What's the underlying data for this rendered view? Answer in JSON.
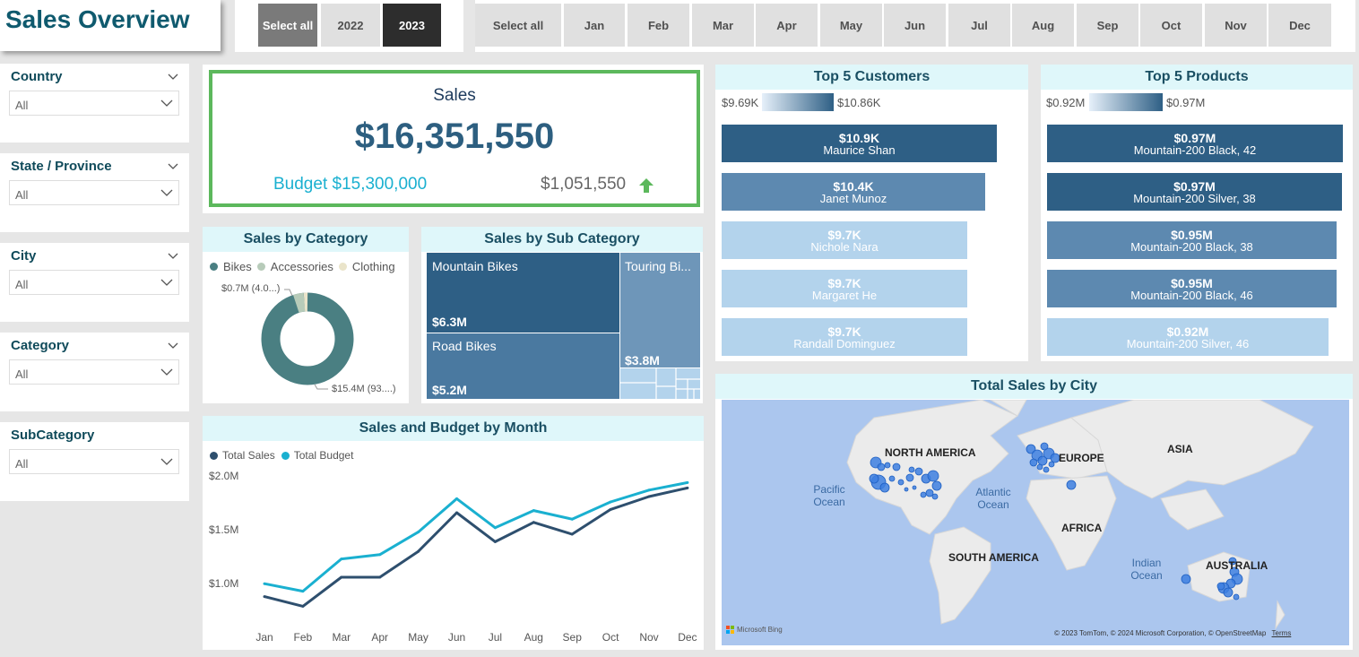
{
  "header": {
    "title": "Sales Overview"
  },
  "year_slicer": {
    "items": [
      "Select all",
      "2022",
      "2023"
    ],
    "selected": "2023"
  },
  "month_slicer": {
    "items": [
      "Select all",
      "Jan",
      "Feb",
      "Mar",
      "Apr",
      "May",
      "Jun",
      "Jul",
      "Aug",
      "Sep",
      "Oct",
      "Nov",
      "Dec"
    ]
  },
  "filters": [
    {
      "label": "Country",
      "value": "All"
    },
    {
      "label": "State / Province",
      "value": "All"
    },
    {
      "label": "City",
      "value": "All"
    },
    {
      "label": "Category",
      "value": "All"
    },
    {
      "label": "SubCategory",
      "value": "All"
    }
  ],
  "kpi": {
    "title": "Sales",
    "value": "$16,351,550",
    "budget": "Budget $15,300,000",
    "variance": "$1,051,550",
    "variance_direction": "up",
    "accent_color": "#5cb85c",
    "budget_color": "#1ab0d0",
    "value_color": "#2d5f80"
  },
  "category_chart": {
    "title": "Sales by Category",
    "legend": [
      "Bikes",
      "Accessories",
      "Clothing"
    ],
    "colors": [
      "#4a7f82",
      "#b7cbb9",
      "#eae4ca"
    ],
    "label_small": "$0.7M (4.0...)",
    "label_big": "$15.4M (93....)"
  },
  "subcategory_chart": {
    "title": "Sales by Sub Category",
    "tiles": [
      {
        "name": "Mountain Bikes",
        "value": "$6.3M"
      },
      {
        "name": "Road Bikes",
        "value": "$5.2M"
      },
      {
        "name": "Touring Bi...",
        "value": "$3.8M"
      }
    ]
  },
  "line_chart": {
    "title": "Sales and Budget by Month",
    "legend": [
      "Total Sales",
      "Total Budget"
    ],
    "y_ticks": [
      "$2.0M",
      "$1.5M",
      "$1.0M"
    ],
    "x_ticks": [
      "Jan",
      "Feb",
      "Mar",
      "Apr",
      "May",
      "Jun",
      "Jul",
      "Aug",
      "Sep",
      "Oct",
      "Nov",
      "Dec"
    ]
  },
  "chart_data": {
    "type": "line",
    "x": [
      "Jan",
      "Feb",
      "Mar",
      "Apr",
      "May",
      "Jun",
      "Jul",
      "Aug",
      "Sep",
      "Oct",
      "Nov",
      "Dec"
    ],
    "series": [
      {
        "name": "Total Sales",
        "color": "#2e4f6e",
        "values": [
          0.87,
          0.78,
          1.05,
          1.05,
          1.29,
          1.65,
          1.38,
          1.56,
          1.45,
          1.68,
          1.8,
          1.88
        ]
      },
      {
        "name": "Total Budget",
        "color": "#1ab0d0",
        "values": [
          0.99,
          0.92,
          1.22,
          1.26,
          1.47,
          1.78,
          1.51,
          1.67,
          1.59,
          1.75,
          1.86,
          1.93
        ]
      }
    ],
    "ylim": [
      0.7,
      2.1
    ],
    "y_unit": "$M",
    "grid": false,
    "legend_position": "top-left"
  },
  "top_customers": {
    "title": "Top 5 Customers",
    "range_min": "$9.69K",
    "range_max": "$10.86K",
    "items": [
      {
        "value": "$10.9K",
        "name": "Maurice Shan",
        "fraction": 1.0,
        "color": "#2e5f85"
      },
      {
        "value": "$10.4K",
        "name": "Janet Munoz",
        "fraction": 0.958,
        "color": "#5d89b0"
      },
      {
        "value": "$9.7K",
        "name": "Nichole Nara",
        "fraction": 0.893,
        "color": "#b3d3ec"
      },
      {
        "value": "$9.7K",
        "name": "Margaret He",
        "fraction": 0.893,
        "color": "#b3d3ec"
      },
      {
        "value": "$9.7K",
        "name": "Randall Dominguez",
        "fraction": 0.893,
        "color": "#b3d3ec"
      }
    ]
  },
  "top_products": {
    "title": "Top 5 Products",
    "range_min": "$0.92M",
    "range_max": "$0.97M",
    "items": [
      {
        "value": "$0.97M",
        "name": "Mountain-200 Black, 42",
        "fraction": 1.0,
        "color": "#2e5f85"
      },
      {
        "value": "$0.97M",
        "name": "Mountain-200 Silver, 38",
        "fraction": 0.997,
        "color": "#2e5f85"
      },
      {
        "value": "$0.95M",
        "name": "Mountain-200 Black, 38",
        "fraction": 0.98,
        "color": "#5d89b0"
      },
      {
        "value": "$0.95M",
        "name": "Mountain-200 Black, 46",
        "fraction": 0.98,
        "color": "#5d89b0"
      },
      {
        "value": "$0.92M",
        "name": "Mountain-200 Silver, 46",
        "fraction": 0.95,
        "color": "#b3d3ec"
      }
    ]
  },
  "map": {
    "title": "Total Sales by City",
    "continents": [
      "NORTH AMERICA",
      "EUROPE",
      "ASIA",
      "AFRICA",
      "SOUTH AMERICA",
      "AUSTRALIA"
    ],
    "oceans": [
      "Pacific Ocean",
      "Atlantic Ocean",
      "Indian Ocean"
    ],
    "brand": "Microsoft Bing",
    "copyright": "© 2023 TomTom, © 2024 Microsoft Corporation, © OpenStreetMap",
    "terms": "Terms"
  }
}
